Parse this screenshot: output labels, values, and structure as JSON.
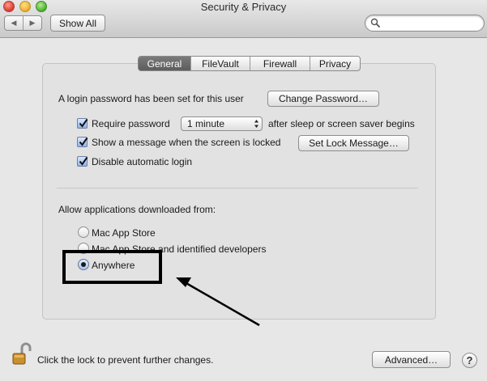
{
  "window": {
    "title": "Security & Privacy",
    "show_all_label": "Show All",
    "search_placeholder": ""
  },
  "tabs": [
    {
      "label": "General",
      "active": true
    },
    {
      "label": "FileVault",
      "active": false
    },
    {
      "label": "Firewall",
      "active": false
    },
    {
      "label": "Privacy",
      "active": false
    }
  ],
  "general": {
    "password_set_text": "A login password has been set for this user",
    "change_password_label": "Change Password…",
    "require_password": {
      "label": "Require password",
      "checked": true
    },
    "require_password_delay": "1 minute",
    "require_password_suffix": "after sleep or screen saver begins",
    "show_message": {
      "label": "Show a message when the screen is locked",
      "checked": true
    },
    "set_lock_message_label": "Set Lock Message…",
    "disable_auto_login": {
      "label": "Disable automatic login",
      "checked": true
    }
  },
  "downloads": {
    "heading": "Allow applications downloaded from:",
    "options": [
      {
        "label": "Mac App Store",
        "selected": false
      },
      {
        "label": "Mac App Store and identified developers",
        "selected": false
      },
      {
        "label": "Anywhere",
        "selected": true
      }
    ]
  },
  "footer": {
    "lock_text": "Click the lock to prevent further changes.",
    "advanced_label": "Advanced…",
    "help_label": "?"
  },
  "colors": {
    "annotation": "#000000",
    "active_tab": "#666666"
  },
  "icons": {
    "lock": "padlock-open-icon",
    "search": "magnifier-icon",
    "back": "chevron-left-icon",
    "forward": "chevron-right-icon"
  }
}
